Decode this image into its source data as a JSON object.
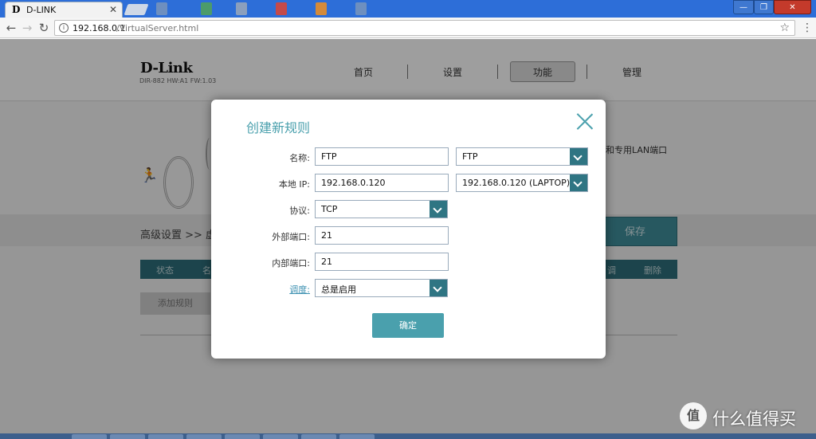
{
  "browser": {
    "tab_title": "D-LINK",
    "tab_favicon": "D",
    "url_host": "192.168.0.1",
    "url_path": "/VirtualServer.html"
  },
  "header": {
    "logo": "D-Link",
    "model": "DIR-882 HW:A1 FW:1.03",
    "nav": [
      "首页",
      "设置",
      "功能",
      "管理"
    ],
    "active_nav": "功能"
  },
  "page": {
    "banner_text": "和专用LAN端口",
    "breadcrumb": "高级设置 >> 虚",
    "save_label": "保存",
    "table_headers": {
      "status": "状态",
      "name": "名",
      "schedule": "调",
      "delete": "删除"
    },
    "add_rule_label": "添加规则"
  },
  "modal": {
    "title": "创建新规则",
    "fields": {
      "name_label": "名称:",
      "name_value": "FTP",
      "name_preset": "FTP",
      "ip_label": "本地 IP:",
      "ip_value": "192.168.0.120",
      "ip_device": "192.168.0.120 (LAPTOP)",
      "protocol_label": "协议:",
      "protocol_value": "TCP",
      "ext_port_label": "外部端口:",
      "ext_port_value": "21",
      "int_port_label": "内部端口:",
      "int_port_value": "21",
      "schedule_label": "调度:",
      "schedule_value": "总是启用"
    },
    "ok_label": "确定"
  },
  "watermark": {
    "logo": "值",
    "text": "什么值得买"
  },
  "colors": {
    "accent": "#4aa0ad",
    "dark_teal": "#2e6f7b",
    "titlebar": "#2d6ed8"
  }
}
